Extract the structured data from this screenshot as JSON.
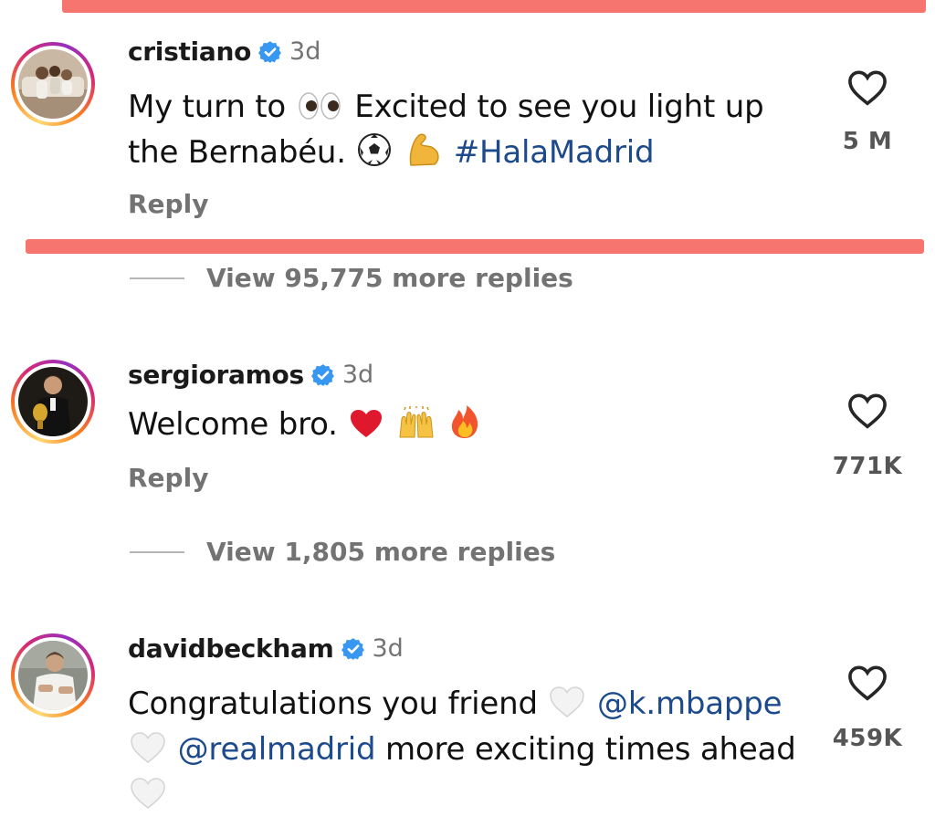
{
  "comments": [
    {
      "username": "cristiano",
      "time": "3d",
      "text_line1_a": "My turn to",
      "text_line1_b": "Excited to see you light up",
      "text_line2_a": "the Bernabéu.",
      "hashtag": "#HalaMadrid",
      "likes": "5 M",
      "reply_label": "Reply",
      "view_replies": "View 95,775 more replies"
    },
    {
      "username": "sergioramos",
      "time": "3d",
      "text": "Welcome bro.",
      "likes": "771K",
      "reply_label": "Reply",
      "view_replies": "View 1,805 more replies"
    },
    {
      "username": "davidbeckham",
      "time": "3d",
      "text_line1": "Congratulations you friend",
      "mention1": "@k.mbappe",
      "mention2": "@realmadrid",
      "text_line2": "more exciting times ahead",
      "likes": "459K"
    }
  ],
  "icons": {
    "verified": "verified-badge-icon",
    "heart": "heart-outline-icon",
    "eyes": "eyes-emoji",
    "soccer": "soccer-ball-emoji",
    "muscle": "flexed-biceps-emoji",
    "red_heart": "red-heart-emoji",
    "raised_hands": "raising-hands-emoji",
    "fire": "fire-emoji",
    "white_heart": "white-heart-emoji"
  },
  "colors": {
    "highlight": "#f6756e",
    "hashtag": "#1c4a8d",
    "verified": "#3897f0",
    "secondary_text": "#737373"
  }
}
